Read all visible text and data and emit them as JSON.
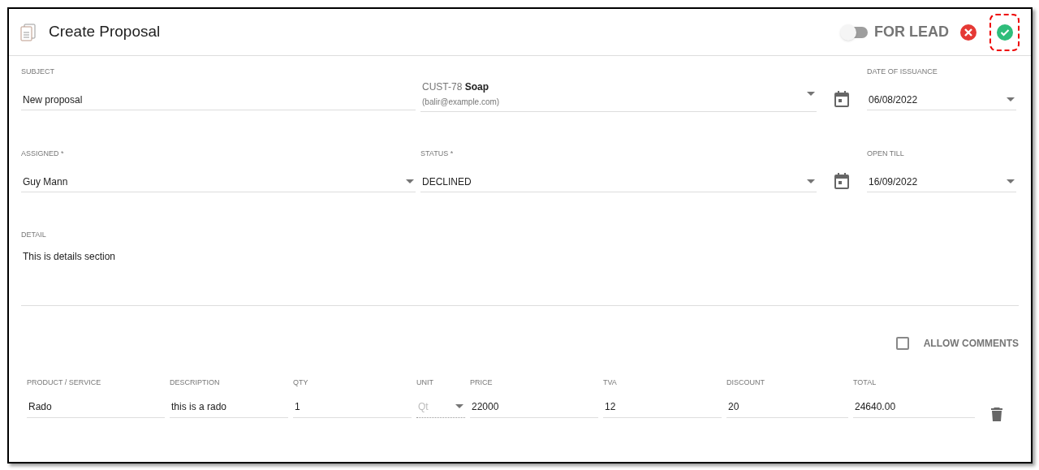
{
  "header": {
    "title": "Create Proposal",
    "for_lead": {
      "label": "FOR LEAD",
      "on": false
    }
  },
  "subject": {
    "label": "SUBJECT",
    "value": "New proposal"
  },
  "customer": {
    "code": "CUST-78",
    "name": "Soap",
    "email": "(balir@example.com)"
  },
  "date_of_issuance": {
    "label": "DATE OF ISSUANCE",
    "value": "06/08/2022"
  },
  "assigned": {
    "label": "ASSIGNED *",
    "value": "Guy Mann"
  },
  "status": {
    "label": "STATUS *",
    "value": "DECLINED"
  },
  "open_till": {
    "label": "OPEN TILL",
    "value": "16/09/2022"
  },
  "detail": {
    "label": "DETAIL",
    "value": "This is details section"
  },
  "allow_comments": {
    "label": "ALLOW COMMENTS",
    "checked": false
  },
  "line_items": {
    "columns": [
      "PRODUCT / SERVICE",
      "DESCRIPTION",
      "QTY",
      "UNIT",
      "PRICE",
      "TVA",
      "DISCOUNT",
      "TOTAL"
    ],
    "rows": [
      {
        "product": "Rado",
        "description": "this is a rado",
        "qty": "1",
        "unit_placeholder": "Qt",
        "price": "22000",
        "tva": "12",
        "discount": "20",
        "total": "24640.00"
      }
    ]
  }
}
